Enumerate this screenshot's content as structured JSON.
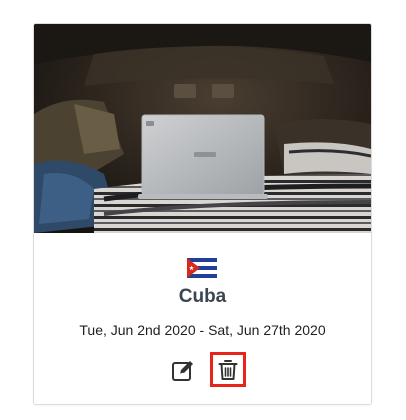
{
  "card": {
    "country": "Cuba",
    "dates": "Tue, Jun 2nd 2020 - Sat, Jun 27th 2020",
    "flag_icon": "cuba-flag-icon",
    "image_subject": "laptop-in-car-trunk-photo"
  },
  "actions": {
    "edit_icon": "edit-icon",
    "delete_icon": "trash-icon",
    "highlight_color": "#e8231a"
  }
}
